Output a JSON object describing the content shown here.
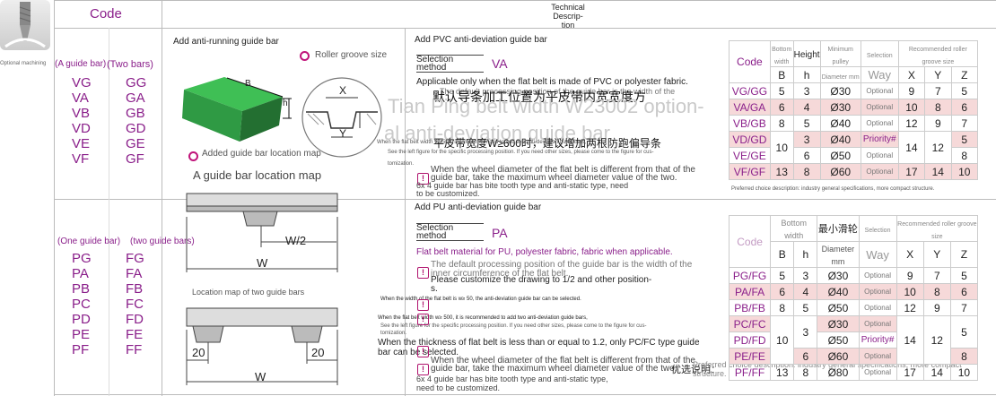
{
  "header": {
    "code_label": "Code",
    "tech_desc_label": "Technical Descrip-\ntion"
  },
  "sidebar": {
    "caption": "Optional machining"
  },
  "block1": {
    "col1_head": "(A guide bar)",
    "col2_head": "(Two bars)",
    "col1": [
      "VG",
      "VA",
      "VB",
      "VD",
      "VE",
      "VF"
    ],
    "col2": [
      "GG",
      "GA",
      "GB",
      "GD",
      "GE",
      "GF"
    ],
    "title": "Add anti-running guide bar",
    "roller_groove": "Roller groove size",
    "location_map_small": "Added guide bar location map",
    "location_map": "A guide bar location map",
    "label_B": "B",
    "label_h": "h",
    "label_X": "X",
    "label_Y": "Y",
    "label_W2": "W/2",
    "label_W": "W"
  },
  "block2": {
    "col1_head": "(One guide bar)",
    "col2_head": "(two guide bars)",
    "col1": [
      "PG",
      "PA",
      "PB",
      "PC",
      "PD",
      "PE",
      "PF"
    ],
    "col2": [
      "FG",
      "FA",
      "FB",
      "FC",
      "FD",
      "FE",
      "FF"
    ],
    "location_map": "Location map of two guide bars",
    "label_20a": "20",
    "label_20b": "20",
    "label_W": "W"
  },
  "pvc": {
    "title": "Add PVC anti-deviation guide bar",
    "selection": "Selection method",
    "code": "VA",
    "line1": "Applicable only when the flat belt is made of PVC or polyester fabric.",
    "line1b": "The default processing position of the guide bar is the width of the",
    "cn1": "默认导条加工位置为平皮带内宽宽度方",
    "cn2": "平皮带宽度W≥600时，建议增加两根防跑偏导条",
    "small1": "When the flat belt width W≥500, it is recommended to add two anti-deviation guide bars,",
    "small2": "See the left figure for the specific processing position. If you need other sizes, please come to the figure for cus-",
    "small3": "tomization.",
    "note1": "When the wheel diameter of the flat belt is different from that of the",
    "note2": "guide bar, take the maximum wheel diameter value of the two.",
    "note3": "6x 4 guide bar has bite tooth type and anti-static type, need",
    "note4": "to be customized.",
    "watermark1": "Tian Ping belt width W23002 option-",
    "watermark2": "al anti-deviation guide bar",
    "preferred": "Preferred choice description: industry general specifications, more compact structure."
  },
  "pu": {
    "title": "Add PU anti-deviation guide bar",
    "selection": "Selection method",
    "code": "PA",
    "line1": "Flat belt material for PU, polyester fabric, fabric when applicable.",
    "line2": "The default processing position of the guide bar is the width of the",
    "line3": "inner circumference of the flat belt.",
    "line4": "Please customize the drawing to 1/2 and other position-",
    "line5": "s.",
    "small1": "When the width of the flat belt is w≥ 50, the anti-deviation guide bar can be selected.",
    "small2": "When the flat belt width w≥ 500, it is recommended to add two anti-deviation guide bars,",
    "small3": "See the left figure for the specific processing position. If you need other sizes, please come to the figure for cus-",
    "small4": "tomization.",
    "note_thick1": "When the thickness of flat belt is less than or equal to 1.2, only PC/FC type guide",
    "note_thick2": "bar can be selected.",
    "note1": "When the wheel diameter of the flat belt is different from that of the",
    "note2": "guide bar, take the maximum wheel diameter value of the two.",
    "note3": "6x 4 guide bar has bite tooth type and anti-static type,",
    "note4": "need to be customized.",
    "preferred": "Preferred choice description: industry general specifications, more compact structure.",
    "cn_pref": "优选说明："
  },
  "table1": {
    "h_code": "Code",
    "h_bottom": "Bottom width",
    "h_height": "Height",
    "h_min": "Minimum pulley",
    "h_diam": "Diameter mm",
    "h_sel": "Selection",
    "h_way": "Way",
    "h_rec": "Recommended roller groove size",
    "h_B": "B",
    "h_h": "h",
    "h_X": "X",
    "h_Y": "Y",
    "h_Z": "Z",
    "rows": [
      {
        "code": "VG/GG",
        "B": "5",
        "h": "3",
        "d": "Ø30",
        "way": "Optional",
        "X": "9",
        "Y": "7",
        "Z": "5"
      },
      {
        "code": "VA/GA",
        "B": "6",
        "h": "4",
        "d": "Ø30",
        "way": "Optional",
        "X": "10",
        "Y": "8",
        "Z": "6"
      },
      {
        "code": "VB/GB",
        "B": "8",
        "h": "5",
        "d": "Ø40",
        "way": "Optional",
        "X": "12",
        "Y": "9",
        "Z": "7"
      },
      {
        "code": "VD/GD",
        "B": "10",
        "h": "3",
        "d": "Ø40",
        "way": "Priority#",
        "X": "14",
        "Y": "12",
        "Z": "5"
      },
      {
        "code": "VE/GE",
        "B": "",
        "h": "6",
        "d": "Ø50",
        "way": "Optional",
        "X": "",
        "Y": "",
        "Z": "8"
      },
      {
        "code": "VF/GF",
        "B": "13",
        "h": "8",
        "d": "Ø60",
        "way": "Optional",
        "X": "17",
        "Y": "14",
        "Z": "10"
      }
    ]
  },
  "table2": {
    "h_code": "Code",
    "h_bottom": "Bottom width",
    "h_min": "最小滑轮",
    "h_diam": "Diameter mm",
    "h_sel": "Selection",
    "h_way": "Way",
    "h_rec": "Recommended roller groove size",
    "h_B": "B",
    "h_h": "h",
    "h_X": "X",
    "h_Y": "Y",
    "h_Z": "Z",
    "rows": [
      {
        "code": "PG/FG",
        "B": "5",
        "h": "3",
        "d": "Ø30",
        "way": "Optional",
        "X": "9",
        "Y": "7",
        "Z": "5"
      },
      {
        "code": "PA/FA",
        "B": "6",
        "h": "4",
        "d": "Ø40",
        "way": "Optional",
        "X": "10",
        "Y": "8",
        "Z": "6"
      },
      {
        "code": "PB/FB",
        "B": "8",
        "h": "5",
        "d": "Ø50",
        "way": "Optional",
        "X": "12",
        "Y": "9",
        "Z": "7"
      },
      {
        "code": "PC/FC",
        "B": "",
        "h": "",
        "d": "Ø30",
        "way": "Optional",
        "X": "",
        "Y": "",
        "Z": ""
      },
      {
        "code": "PD/FD",
        "B": "10",
        "h": "3",
        "d": "Ø50",
        "way": "Priority#",
        "X": "14",
        "Y": "12",
        "Z": "5"
      },
      {
        "code": "PE/FE",
        "B": "",
        "h": "6",
        "d": "Ø60",
        "way": "Optional",
        "X": "",
        "Y": "",
        "Z": "8"
      },
      {
        "code": "PF/FF",
        "B": "13",
        "h": "8",
        "d": "Ø80",
        "way": "Optional",
        "X": "17",
        "Y": "14",
        "Z": "10"
      }
    ]
  }
}
